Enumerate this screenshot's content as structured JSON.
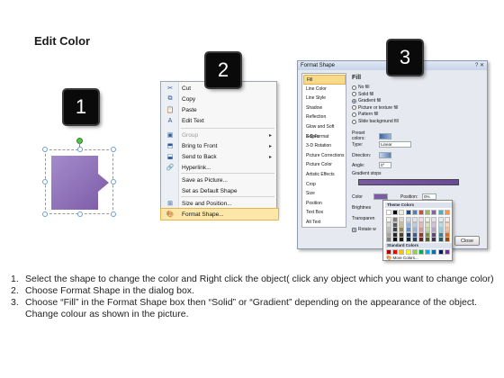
{
  "title": "Edit Color",
  "badges": [
    "1",
    "2",
    "3"
  ],
  "shape": {
    "fill_color": "#7b5aa6",
    "highlight_color": "#a48ccc"
  },
  "context_menu": {
    "items": [
      {
        "label": "Cut",
        "icon": "scissors-icon",
        "glyph": "✂",
        "disabled": false,
        "submenu": false
      },
      {
        "label": "Copy",
        "icon": "copy-icon",
        "glyph": "⧉",
        "disabled": false,
        "submenu": false
      },
      {
        "label": "Paste",
        "icon": "paste-icon",
        "glyph": "📋",
        "disabled": false,
        "submenu": false
      },
      {
        "label": "Edit Text",
        "icon": "edit-text-icon",
        "glyph": "A",
        "disabled": false,
        "submenu": false
      },
      {
        "label": "Group",
        "icon": "group-icon",
        "glyph": "▣",
        "disabled": true,
        "submenu": true
      },
      {
        "label": "Bring to Front",
        "icon": "bring-front-icon",
        "glyph": "⬒",
        "disabled": false,
        "submenu": true
      },
      {
        "label": "Send to Back",
        "icon": "send-back-icon",
        "glyph": "⬓",
        "disabled": false,
        "submenu": true
      },
      {
        "label": "Hyperlink...",
        "icon": "hyperlink-icon",
        "glyph": "🔗",
        "disabled": false,
        "submenu": false
      },
      {
        "label": "Save as Picture...",
        "icon": "",
        "glyph": "",
        "disabled": false,
        "submenu": false
      },
      {
        "label": "Set as Default Shape",
        "icon": "",
        "glyph": "",
        "disabled": false,
        "submenu": false
      },
      {
        "label": "Size and Position...",
        "icon": "size-icon",
        "glyph": "⊞",
        "disabled": false,
        "submenu": false
      },
      {
        "label": "Format Shape...",
        "icon": "format-shape-icon",
        "glyph": "🎨",
        "disabled": false,
        "submenu": false,
        "highlighted": true
      }
    ]
  },
  "format_dialog": {
    "title": "Format Shape",
    "window_buttons": "? ✕",
    "categories": [
      "Fill",
      "Line Color",
      "Line Style",
      "Shadow",
      "Reflection",
      "Glow and Soft Edges",
      "3-D Format",
      "3-D Rotation",
      "Picture Corrections",
      "Picture Color",
      "Artistic Effects",
      "Crop",
      "Size",
      "Position",
      "Text Box",
      "Alt Text"
    ],
    "selected_category": "Fill",
    "pane_title": "Fill",
    "fill_options": [
      {
        "label": "No fill",
        "on": false
      },
      {
        "label": "Solid fill",
        "on": false
      },
      {
        "label": "Gradient fill",
        "on": true
      },
      {
        "label": "Picture or texture fill",
        "on": false
      },
      {
        "label": "Pattern fill",
        "on": false
      },
      {
        "label": "Slide background fill",
        "on": false
      }
    ],
    "preset_colors_label": "Preset colors:",
    "type_label": "Type:",
    "type_value": "Linear",
    "direction_label": "Direction:",
    "angle_label": "Angle:",
    "angle_value": "0°",
    "gradient_stops_label": "Gradient stops",
    "color_label": "Color",
    "position_label": "Position:",
    "position_value": "0%",
    "brightness_label": "Brightnes",
    "transparency_label": "Transparen",
    "rotate_label": "Rotate w",
    "close_label": "Close"
  },
  "color_picker": {
    "theme_header": "Theme Colors",
    "standard_header": "Standard Colors",
    "more_label": "More Colors...",
    "theme_top": [
      "#ffffff",
      "#000000",
      "#eeece1",
      "#1f497d",
      "#4f81bd",
      "#c0504d",
      "#9bbb59",
      "#8064a2",
      "#4bacc6",
      "#f79646"
    ],
    "theme_shades": [
      [
        "#f2f2f2",
        "#7f7f7f",
        "#ddd9c3",
        "#c6d9f0",
        "#dbe5f1",
        "#f2dcdb",
        "#ebf1dd",
        "#e5e0ec",
        "#dbeef3",
        "#fdeada"
      ],
      [
        "#d8d8d8",
        "#595959",
        "#c4bd97",
        "#8db3e2",
        "#b8cce4",
        "#e5b9b7",
        "#d7e3bc",
        "#ccc1d9",
        "#b7dde8",
        "#fbd5b5"
      ],
      [
        "#bfbfbf",
        "#3f3f3f",
        "#938953",
        "#548dd4",
        "#95b3d7",
        "#d99694",
        "#c3d69b",
        "#b2a2c7",
        "#92cddc",
        "#fac08f"
      ],
      [
        "#a5a5a5",
        "#262626",
        "#494429",
        "#17365d",
        "#366092",
        "#953734",
        "#76923c",
        "#5f497a",
        "#31859b",
        "#e36c09"
      ],
      [
        "#7f7f7f",
        "#0c0c0c",
        "#1d1b10",
        "#0f243e",
        "#244061",
        "#632423",
        "#4f6128",
        "#3f3151",
        "#205867",
        "#974806"
      ]
    ],
    "standard": [
      "#c00000",
      "#ff0000",
      "#ffc000",
      "#ffff00",
      "#92d050",
      "#00b050",
      "#00b0f0",
      "#0070c0",
      "#002060",
      "#7030a0"
    ]
  },
  "steps": [
    {
      "n": "1.",
      "text": "Select the shape to change the color and Right click the object( click any object which you want to change color)"
    },
    {
      "n": "2.",
      "text": "Choose Format Shape in the dialog box."
    },
    {
      "n": "3.",
      "text": "Choose “Fill” in the Format Shape box then “Solid” or “Gradient” depending on the appearance of the object. Change colour as shown in the picture."
    }
  ]
}
